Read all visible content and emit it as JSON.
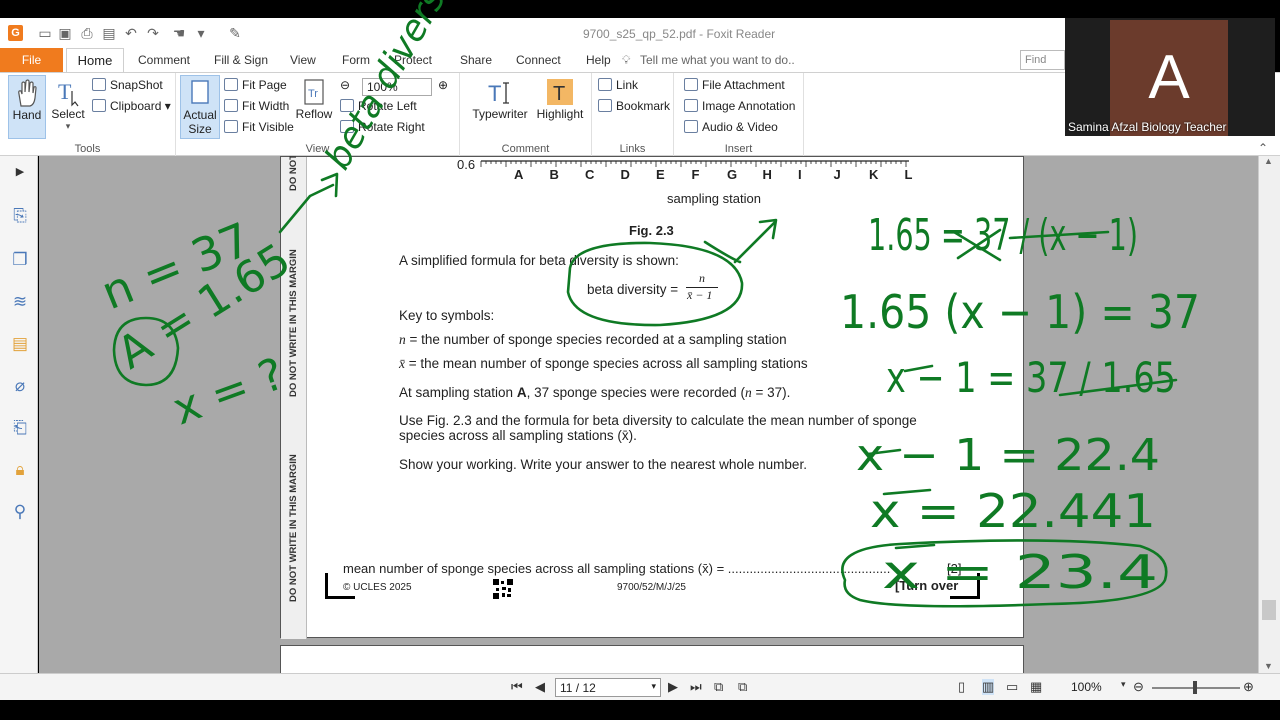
{
  "window": {
    "title": "9700_s25_qp_52.pdf - Foxit Reader",
    "logo": "G"
  },
  "quick_access": [
    "save-icon",
    "print-icon",
    "undo-icon",
    "redo-icon",
    "hand-icon",
    "pen-icon"
  ],
  "tabs": {
    "file": "File",
    "home": "Home",
    "comment": "Comment",
    "fill_sign": "Fill & Sign",
    "view": "View",
    "form": "Form",
    "protect": "Protect",
    "share": "Share",
    "connect": "Connect",
    "help": "Help",
    "tell_me": "Tell me what you want to do..",
    "find": "Find"
  },
  "ribbon": {
    "tools": {
      "label": "Tools",
      "hand": "Hand",
      "select": "Select",
      "snapshot": "SnapShot",
      "clipboard": "Clipboard"
    },
    "view": {
      "label": "View",
      "actual_size_1": "Actual",
      "actual_size_2": "Size",
      "fit_page": "Fit Page",
      "fit_width": "Fit Width",
      "fit_visible": "Fit Visible",
      "reflow": "Reflow",
      "zoom": "100%",
      "rotate_left": "Rotate Left",
      "rotate_right": "Rotate Right"
    },
    "comment": {
      "label": "Comment",
      "typewriter": "Typewriter",
      "highlight": "Highlight"
    },
    "links": {
      "label": "Links",
      "link": "Link",
      "bookmark": "Bookmark"
    },
    "insert": {
      "label": "Insert",
      "file_attachment": "File Attachment",
      "image_annotation": "Image Annotation",
      "audio_video": "Audio & Video"
    }
  },
  "webcam": {
    "initial": "A",
    "name": "Samina Afzal Biology Teacher"
  },
  "document": {
    "margin_text": "DO NOT WRITE IN THIS MARGIN",
    "margin_text_short": "DO NOT",
    "axis_tick_y": "0.6",
    "stations": [
      "A",
      "B",
      "C",
      "D",
      "E",
      "F",
      "G",
      "H",
      "I",
      "J",
      "K",
      "L"
    ],
    "x_axis_label": "sampling station",
    "fig_caption": "Fig. 2.3",
    "formula_intro": "A simplified formula for beta diversity is shown:",
    "formula_lhs": "beta diversity =",
    "formula_num": "n",
    "formula_den": "x̄ − 1",
    "key_title": "Key to symbols:",
    "key_n_sym": "n",
    "key_n": " = the number of sponge species recorded at a sampling station",
    "key_x_sym": "x̄",
    "key_x": " = the mean number of sponge species across all sampling stations",
    "station_a_pre": "At sampling station ",
    "station_a_bold": "A",
    "station_a_post": ", 37 sponge species were recorded (",
    "station_a_n": "n",
    "station_a_end": " = 37).",
    "instruction_1": "Use Fig. 2.3 and the formula for beta diversity to calculate the mean number of sponge",
    "instruction_2": "species across all sampling stations (x̄).",
    "instruction_3": "Show your working. Write your answer to the nearest whole number.",
    "answer_line": "mean number of sponge species across all sampling stations (x̄) =  .............................................",
    "marks": "[2]",
    "copyright": "© UCLES 2025",
    "paper_code": "9700/52/M/J/25",
    "turn_over": "[Turn over"
  },
  "annotations": {
    "rotated": "beta diversity",
    "left": [
      "n = 37",
      "A = 1.65",
      "x = ?"
    ],
    "right": [
      "1.65 = 37 / (x − 1)",
      "1.65 (x − 1) = 37",
      "x − 1 = 37 / 1.65",
      "x − 1 = 22.4",
      "x = 22.441",
      "x = 23.4"
    ]
  },
  "statusbar": {
    "page": "11 / 12",
    "zoom": "100%"
  },
  "colors": {
    "accent": "#f07b1e",
    "ink": "#0f7a24",
    "viewer_bg": "#a9a9a9"
  }
}
